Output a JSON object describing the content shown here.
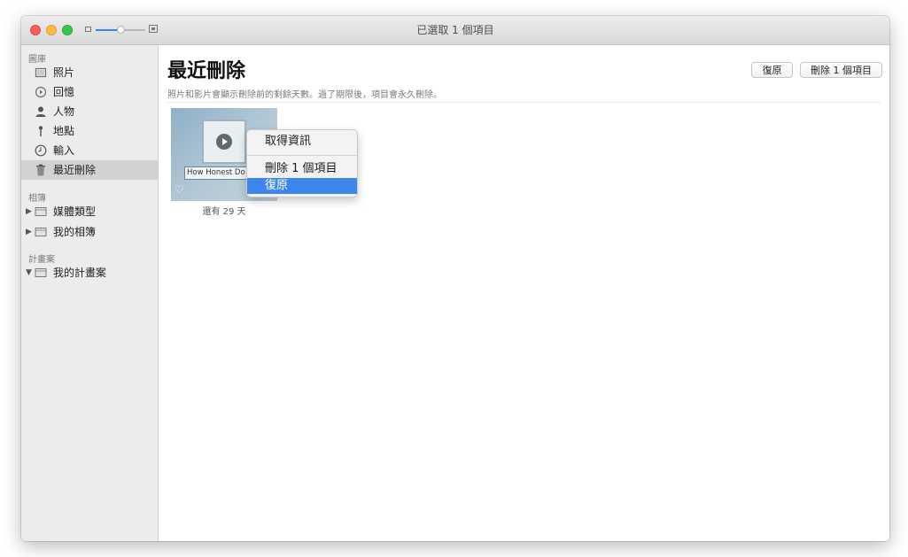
{
  "window": {
    "title": "已選取 1 個項目",
    "zoom_level_fraction": 0.5
  },
  "sidebar": {
    "sections": [
      {
        "header": "圖庫",
        "items": [
          {
            "label": "照片",
            "icon": "photos-icon"
          },
          {
            "label": "回憶",
            "icon": "memories-icon"
          },
          {
            "label": "人物",
            "icon": "people-icon"
          },
          {
            "label": "地點",
            "icon": "places-icon"
          },
          {
            "label": "輸入",
            "icon": "imports-icon"
          },
          {
            "label": "最近刪除",
            "icon": "trash-icon",
            "selected": true
          }
        ]
      },
      {
        "header": "相簿",
        "items": [
          {
            "label": "媒體類型",
            "icon": "album-icon",
            "disclosure": "collapsed"
          },
          {
            "label": "我的相簿",
            "icon": "album-icon",
            "disclosure": "collapsed"
          }
        ]
      },
      {
        "header": "計畫案",
        "items": [
          {
            "label": "我的計畫案",
            "icon": "album-icon",
            "disclosure": "expanded"
          }
        ]
      }
    ]
  },
  "main": {
    "title": "最近刪除",
    "subtitle": "照片和影片會顯示刪除前的剩餘天數。過了期限後，項目會永久刪除。",
    "buttons": {
      "restore": "復原",
      "delete": "刪除 1 個項目"
    },
    "items": [
      {
        "caption": "How Honest Do You Want Me To Be",
        "days_left": "還有 29 天"
      }
    ]
  },
  "context_menu": {
    "items": [
      {
        "label": "取得資訊"
      },
      {
        "label": "刪除 1 個項目"
      },
      {
        "label": "復原",
        "highlighted": true
      }
    ]
  },
  "colors": {
    "accent": "#3d86ec",
    "sidebar_bg": "#ececec",
    "selection_bg": "#d2d2d2"
  }
}
